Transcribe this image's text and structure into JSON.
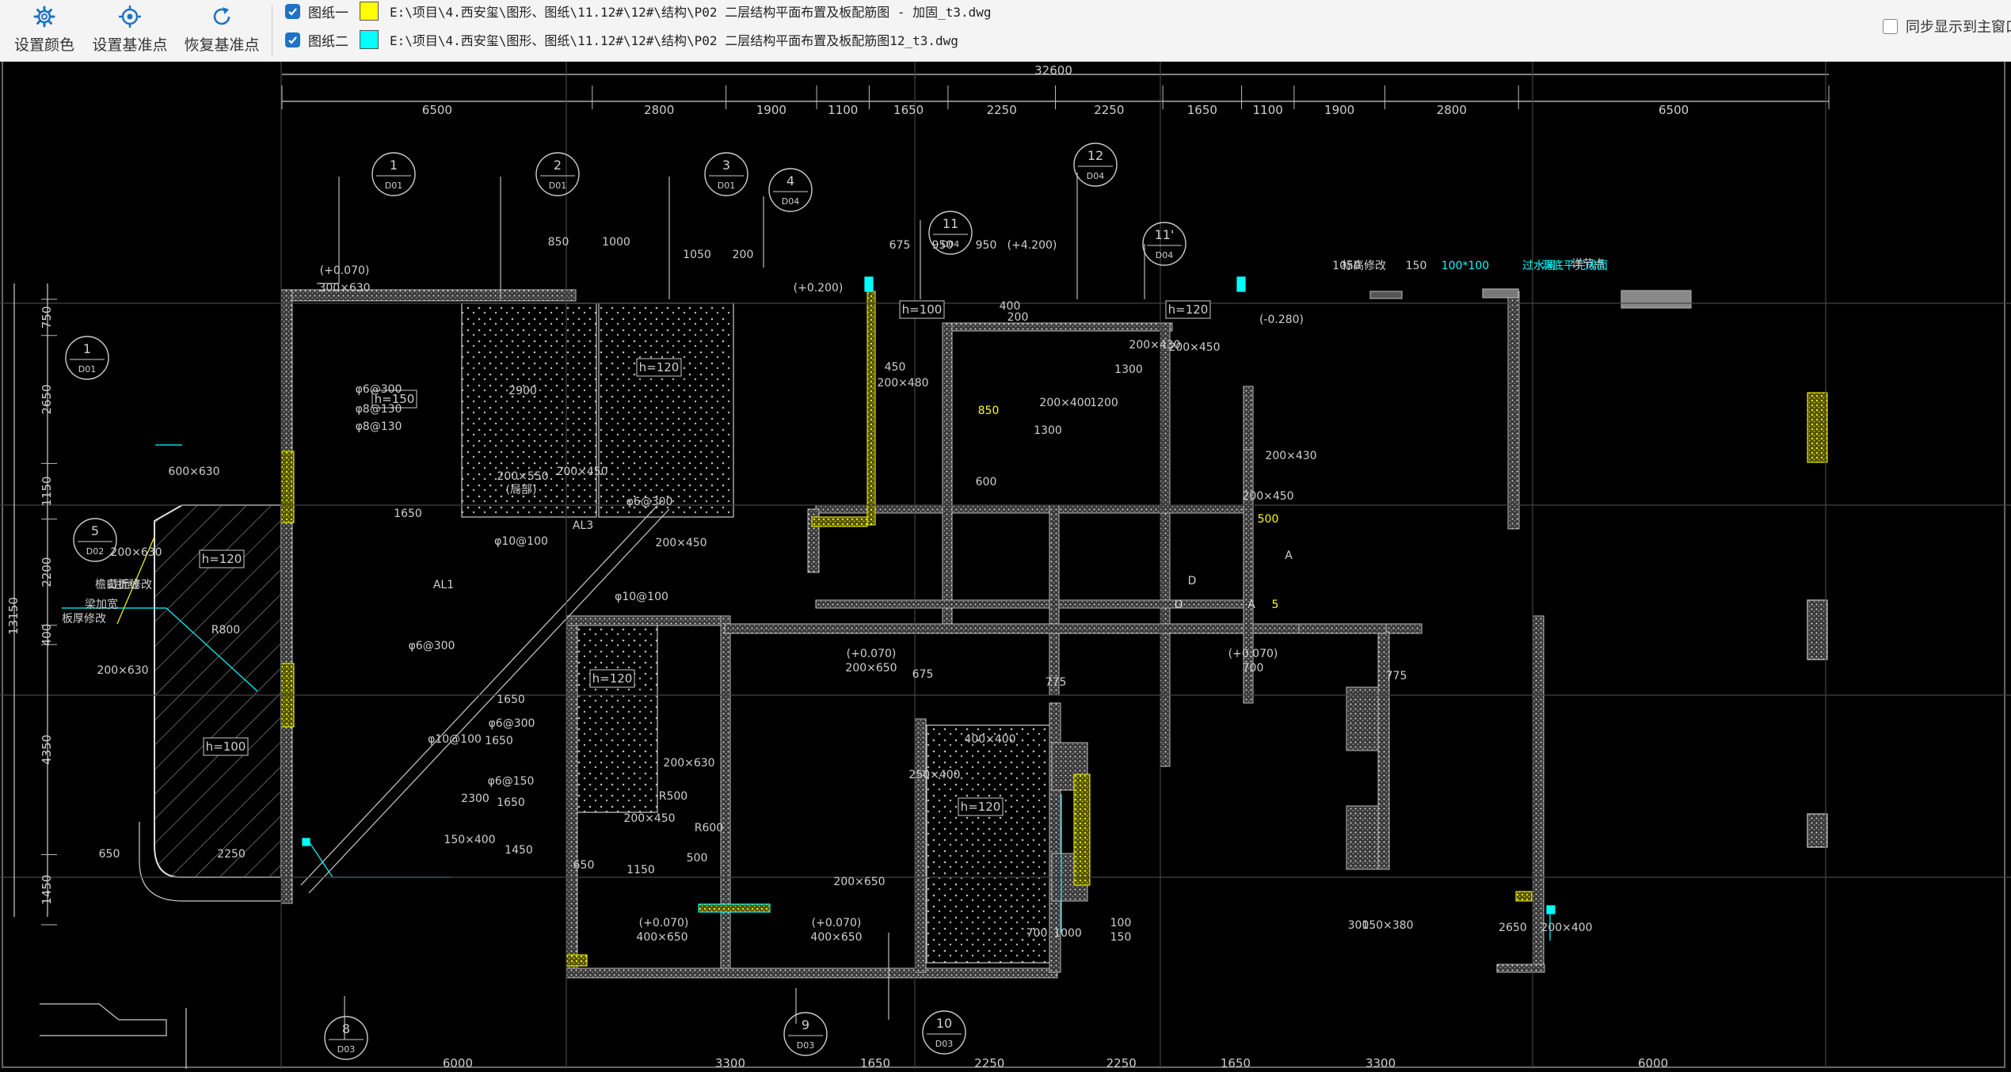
{
  "toolbar": {
    "buttons": [
      {
        "label": "设置颜色",
        "icon": "gear-icon"
      },
      {
        "label": "设置基准点",
        "icon": "crosshair-icon"
      },
      {
        "label": "恢复基准点",
        "icon": "refresh-icon"
      }
    ],
    "drawings": [
      {
        "label": "图纸一",
        "checked": true,
        "color": "#ffff00",
        "path": "E:\\项目\\4.西安玺\\图形、图纸\\11.12#\\12#\\结构\\P02 二层结构平面布置及板配筋图 - 加固_t3.dwg"
      },
      {
        "label": "图纸二",
        "checked": true,
        "color": "#00ffff",
        "path": "E:\\项目\\4.西安玺\\图形、图纸\\11.12#\\12#\\结构\\P02 二层结构平面布置及板配筋图12_t3.dwg"
      }
    ],
    "sync_label": "同步显示到主窗口",
    "sync_checked": false
  },
  "cad": {
    "total_dim": "32600",
    "top_dims": [
      "6500",
      "2800",
      "1900",
      "1100",
      "1650",
      "2250",
      "2250",
      "1650",
      "1100",
      "1900",
      "2800",
      "6500"
    ],
    "left_dims": [
      "750",
      "2650",
      "1150",
      "2200",
      "400",
      "4350",
      "1450"
    ],
    "left_total": "13150",
    "bottom_dims": [
      "6000",
      "3300",
      "1650",
      "2250",
      "2250",
      "1650",
      "3300",
      "6000"
    ],
    "details": [
      {
        "num": "1",
        "ref": "D01"
      },
      {
        "num": "2",
        "ref": "D01"
      },
      {
        "num": "3",
        "ref": "D01"
      },
      {
        "num": "4",
        "ref": "D04"
      },
      {
        "num": "11",
        "ref": "D04"
      },
      {
        "num": "12",
        "ref": "D04"
      },
      {
        "num": "11'",
        "ref": "D04"
      },
      {
        "num": "1",
        "ref": "D01"
      },
      {
        "num": "5",
        "ref": "D02"
      },
      {
        "num": "8",
        "ref": "D03"
      },
      {
        "num": "9",
        "ref": "D03"
      },
      {
        "num": "10",
        "ref": "D03"
      }
    ],
    "slab_labels": [
      "h=150",
      "h=120",
      "h=120",
      "h=120",
      "h=100",
      "h=100",
      "h=120",
      "h=120"
    ],
    "annotations": [
      "(+0.070)",
      "300×630",
      "850",
      "1000",
      "1050",
      "200",
      "2900",
      "200×550",
      "(局部)",
      "200×450",
      "1650",
      "φ6@300",
      "φ8@130",
      "φ8@130",
      "φ10@100",
      "AL3",
      "φ6@300",
      "200×450",
      "φ10@100",
      "AL1",
      "φ6@300",
      "1650",
      "φ6@300",
      "1650",
      "φ10@100",
      "φ6@150",
      "1650",
      "150×400",
      "1450",
      "2300",
      "200×450",
      "200×630",
      "R500",
      "R600",
      "R800",
      "600×630",
      "200×630",
      "200×630",
      "650",
      "2250",
      "500",
      "650",
      "1150",
      "200×650",
      "(+0.070)",
      "400×650",
      "(+0.070)",
      "400×650",
      "(+0.070)",
      "200×650",
      "(+0.070)",
      "700",
      "100",
      "150",
      "700",
      "1000",
      "300",
      "150×380",
      "2650",
      "200×400",
      "400×400",
      "250×400",
      "675",
      "775",
      "775",
      "675",
      "950",
      "950",
      "(+4.200)",
      "200×400",
      "1200",
      "1300",
      "200×480",
      "450",
      "1300",
      "200×430",
      "200×450",
      "200×430",
      "200×450",
      "D",
      "D",
      "A",
      "A",
      "5",
      "500",
      "850",
      "600",
      "200",
      "400",
      "1050",
      "150",
      "100*100",
      "过水洞",
      "洞底平完成面",
      "标高修改",
      "详节点",
      "檐口折线",
      "截面修改",
      "梁加宽",
      "板厚修改",
      "(+0.200)",
      "(-0.280)"
    ]
  }
}
